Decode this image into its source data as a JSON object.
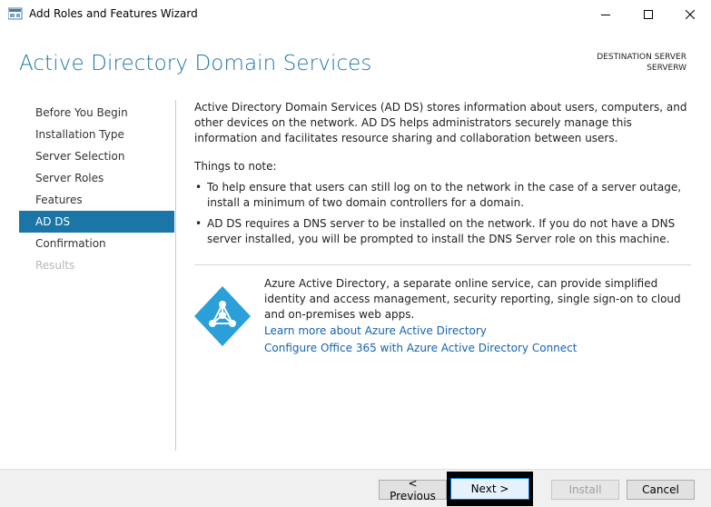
{
  "window": {
    "title": "Add Roles and Features Wizard"
  },
  "header": {
    "page_title": "Active Directory Domain Services",
    "destination_label": "DESTINATION SERVER",
    "destination_name": "SERVERW"
  },
  "nav": {
    "items": [
      {
        "label": "Before You Begin",
        "state": "normal"
      },
      {
        "label": "Installation Type",
        "state": "normal"
      },
      {
        "label": "Server Selection",
        "state": "normal"
      },
      {
        "label": "Server Roles",
        "state": "normal"
      },
      {
        "label": "Features",
        "state": "normal"
      },
      {
        "label": "AD DS",
        "state": "active"
      },
      {
        "label": "Confirmation",
        "state": "normal"
      },
      {
        "label": "Results",
        "state": "disabled"
      }
    ]
  },
  "content": {
    "intro": "Active Directory Domain Services (AD DS) stores information about users, computers, and other devices on the network.  AD DS helps administrators securely manage this information and facilitates resource sharing and collaboration between users.",
    "notes_heading": "Things to note:",
    "bullets": [
      "To help ensure that users can still log on to the network in the case of a server outage, install a minimum of two domain controllers for a domain.",
      "AD DS requires a DNS server to be installed on the network.  If you do not have a DNS server installed, you will be prompted to install the DNS Server role on this machine."
    ],
    "azure_text": "Azure Active Directory, a separate online service, can provide simplified identity and access management, security reporting, single sign-on to cloud and on-premises web apps.",
    "link_learn": "Learn more about Azure Active Directory",
    "link_configure": "Configure Office 365 with Azure Active Directory Connect"
  },
  "footer": {
    "previous_label": "< Previous",
    "next_label": "Next >",
    "install_label": "Install",
    "cancel_label": "Cancel"
  },
  "colors": {
    "accent": "#1b75a6",
    "link": "#1663b0",
    "azure": "#2b9fd8"
  }
}
